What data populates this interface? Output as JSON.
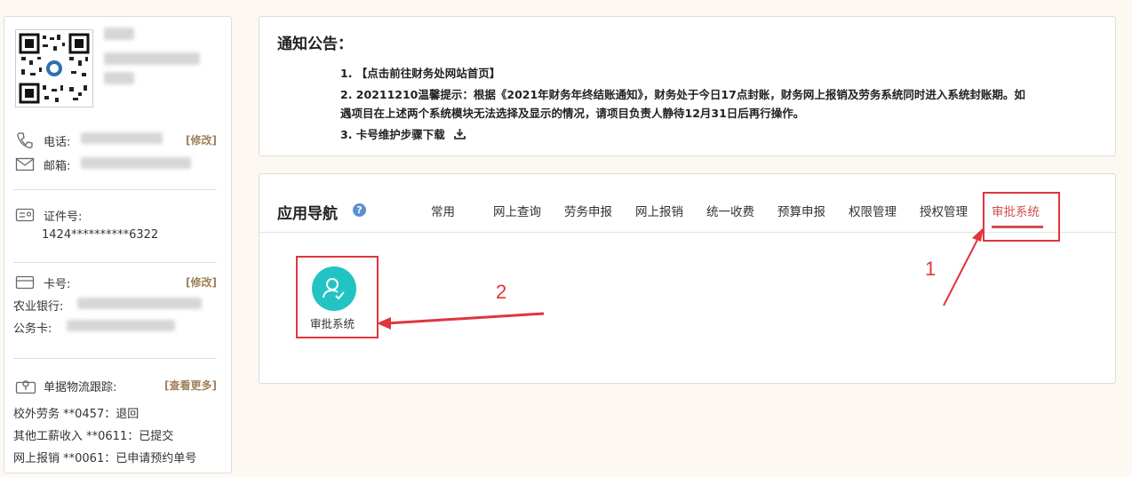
{
  "profile": {
    "phone_label": "电话:",
    "email_label": "邮箱:",
    "edit_label": "[修改]",
    "id_label": "证件号:",
    "id_value": "1424**********6322",
    "card_label": "卡号:",
    "card_edit_label": "[修改]",
    "bank_label": "农业银行:",
    "official_card_label": "公务卡:",
    "tracking_label": "单据物流跟踪:",
    "more_label": "[查看更多]",
    "tracking_items": [
      "校外劳务 **0457：退回",
      "其他工薪收入 **0611：已提交",
      "网上报销 **0061：已申请预约单号"
    ]
  },
  "notice": {
    "title": "通知公告：",
    "items": [
      "1. 【点击前往财务处网站首页】",
      "2. 20211210温馨提示：根据《2021年财务年终结账通知》，财务处于今日17点封账，财务网上报销及劳务系统同时进入系统封账期。如",
      "遇项目在上述两个系统模块无法选择及显示的情况，请项目负责人静待12月31日后再行操作。",
      "3. 卡号维护步骤下载"
    ],
    "download_icon": "download-icon"
  },
  "nav": {
    "title": "应用导航",
    "help_icon": "?",
    "tabs": [
      "常用",
      "网上查询",
      "劳务申报",
      "网上报销",
      "统一收费",
      "预算申报",
      "权限管理",
      "授权管理",
      "审批系统"
    ],
    "active_tab": "审批系统",
    "app_label": "审批系统",
    "app_icon": "user-check-icon"
  },
  "annotations": {
    "step1": "1",
    "step2": "2",
    "color": "#e0353d"
  }
}
